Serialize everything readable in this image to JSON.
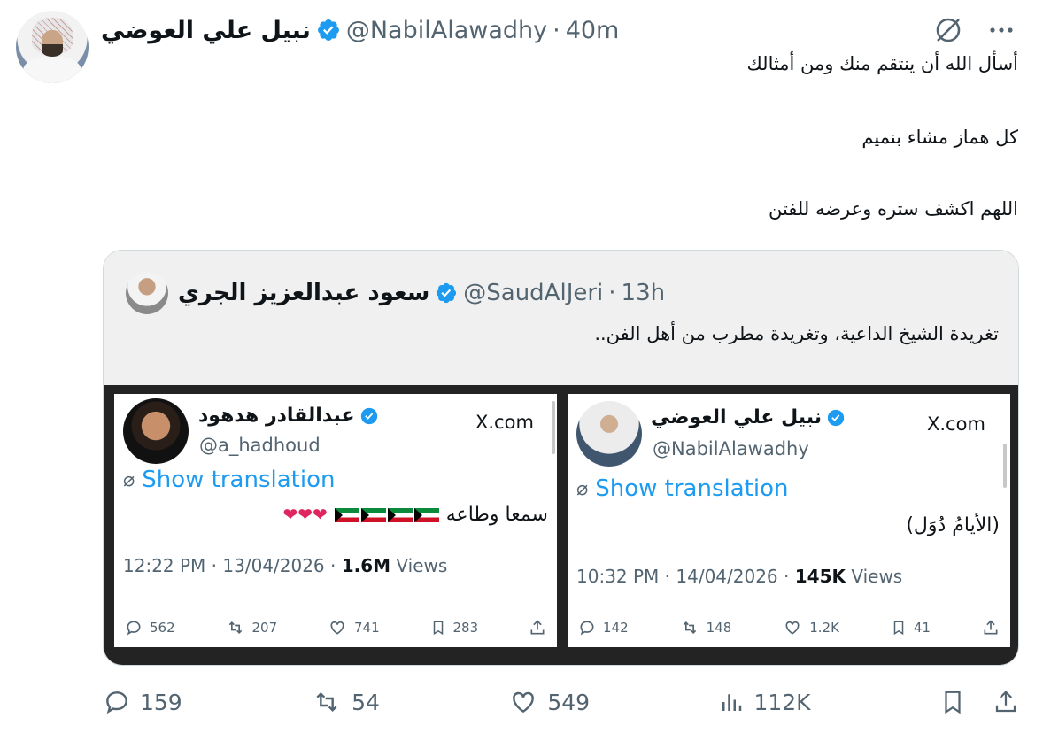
{
  "post": {
    "author_name": "نبيل علي العوضي",
    "handle": "@NabilAlawadhy",
    "time": "40m",
    "body_lines": [
      "أسأل الله أن ينتقم منك ومن أمثالك",
      "كل هماز مشاء بنميم",
      "اللهم اكشف ستره وعرضه للفتن"
    ]
  },
  "quoted": {
    "author_name": "سعود عبدالعزيز الجري",
    "handle": "@SaudAlJeri",
    "time": "13h",
    "text": "تغريدة الشيخ الداعية، وتغريدة مطرب من أهل الفن..",
    "left_panel": {
      "name": "عبدالقادر هدهود",
      "handle": "@a_hadhoud",
      "site": "X.com",
      "translate": "Show translation",
      "body": "سمعا وطاعه",
      "date": "12:22 PM · 13/04/2026 · ",
      "views_count": "1.6M",
      "views_label": " Views",
      "replies": "562",
      "reposts": "207",
      "likes": "741",
      "bookmarks": "283"
    },
    "right_panel": {
      "name": "نبيل علي العوضي",
      "handle": "@NabilAlawadhy",
      "site": "X.com",
      "translate": "Show translation",
      "body": "(الأيامُ دُوَل)",
      "date": "10:32 PM · 14/04/2026 · ",
      "views_count": "145K",
      "views_label": " Views",
      "replies": "142",
      "reposts": "148",
      "likes": "1.2K",
      "bookmarks": "41"
    }
  },
  "actions": {
    "replies": "159",
    "reposts": "54",
    "likes": "549",
    "views": "112K"
  },
  "colors": {
    "accent": "#1d9bf0",
    "muted": "#536471",
    "text": "#0f1419"
  }
}
